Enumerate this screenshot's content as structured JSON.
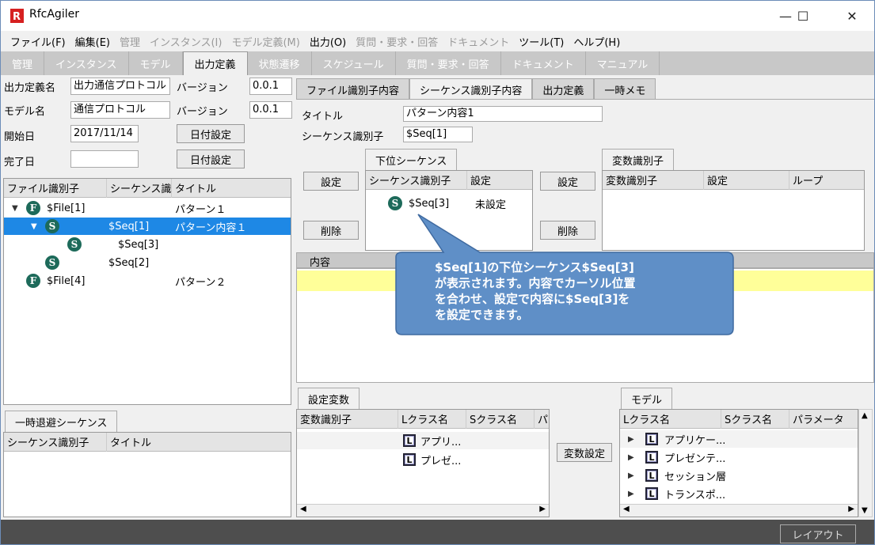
{
  "window": {
    "title": "RfcAgiler",
    "minimize": "—",
    "maximize": "☐",
    "close": "✕"
  },
  "menu": [
    {
      "label": "ファイル(F)",
      "enabled": true
    },
    {
      "label": "編集(E)",
      "enabled": true
    },
    {
      "label": "管理",
      "enabled": false
    },
    {
      "label": "インスタンス(I)",
      "enabled": false
    },
    {
      "label": "モデル定義(M)",
      "enabled": false
    },
    {
      "label": "出力(O)",
      "enabled": true
    },
    {
      "label": "質問・要求・回答",
      "enabled": false
    },
    {
      "label": "ドキュメント",
      "enabled": false
    },
    {
      "label": "ツール(T)",
      "enabled": true
    },
    {
      "label": "ヘルプ(H)",
      "enabled": true
    }
  ],
  "main_tabs": [
    "管理",
    "インスタンス",
    "モデル",
    "出力定義",
    "状態遷移",
    "スケジュール",
    "質問・要求・回答",
    "ドキュメント",
    "マニュアル"
  ],
  "left_form": {
    "output_name_label": "出力定義名",
    "output_name_value": "出力通信プロトコル",
    "version1_label": "バージョン",
    "version1_value": "0.0.1",
    "model_name_label": "モデル名",
    "model_name_value": "通信プロトコル",
    "version2_label": "バージョン",
    "version2_value": "0.0.1",
    "start_label": "開始日",
    "start_value": "2017/11/14",
    "date_btn1": "日付設定",
    "end_label": "完了日",
    "end_value": "",
    "date_btn2": "日付設定"
  },
  "tree": {
    "headers": [
      "ファイル識別子",
      "シーケンス識別",
      "タイトル"
    ],
    "rows": [
      {
        "icon": "F",
        "file": "$File[1]",
        "seq": "",
        "title": "パターン１"
      },
      {
        "icon": "S",
        "file": "",
        "seq": "$Seq[1]",
        "title": "パターン内容１"
      },
      {
        "icon": "S",
        "file": "",
        "seq": "$Seq[3]",
        "title": ""
      },
      {
        "icon": "S",
        "file": "",
        "seq": "$Seq[2]",
        "title": ""
      },
      {
        "icon": "F",
        "file": "$File[4]",
        "seq": "",
        "title": "パターン２"
      }
    ]
  },
  "temp_seq": {
    "tab": "一時退避シーケンス",
    "headers": [
      "シーケンス識別子",
      "タイトル"
    ]
  },
  "right_tabs": [
    "ファイル識別子内容",
    "シーケンス識別子内容",
    "出力定義",
    "一時メモ"
  ],
  "seq_form": {
    "title_label": "タイトル",
    "title_value": "パターン内容1",
    "seq_label": "シーケンス識別子",
    "seq_value": "$Seq[1]"
  },
  "sub_seq": {
    "tab": "下位シーケンス",
    "set_btn": "設定",
    "del_btn": "削除",
    "headers": [
      "シーケンス識別子",
      "設定"
    ],
    "rows": [
      {
        "icon": "S",
        "seq": "$Seq[3]",
        "setting": "未設定"
      }
    ]
  },
  "var_id": {
    "tab": "変数識別子",
    "set_btn": "設定",
    "del_btn": "削除",
    "headers": [
      "変数識別子",
      "設定",
      "ループ"
    ]
  },
  "content": {
    "label": "内容"
  },
  "callout": {
    "lines": [
      "$Seq[1]の下位シーケンス$Seq[3]",
      "が表示されます。内容でカーソル位置",
      "を合わせ、設定で内容に$Seq[3]を",
      "を設定できます。"
    ]
  },
  "set_vars": {
    "tab": "設定変数",
    "headers": [
      "変数識別子",
      "Lクラス名",
      "Sクラス名",
      "パ"
    ],
    "rows": [
      {
        "icon": "L",
        "lclass": "アプリ..."
      },
      {
        "icon": "L",
        "lclass": "プレゼ..."
      }
    ]
  },
  "var_set_btn": "変数設定",
  "model": {
    "tab": "モデル",
    "headers": [
      "Lクラス名",
      "Sクラス名",
      "パラメータ"
    ],
    "rows": [
      {
        "icon": "L",
        "lclass": "アプリケー..."
      },
      {
        "icon": "L",
        "lclass": "プレゼンテ..."
      },
      {
        "icon": "L",
        "lclass": "セッション層"
      },
      {
        "icon": "L",
        "lclass": "トランスポ..."
      }
    ]
  },
  "status": {
    "layout_btn": "レイアウト"
  }
}
